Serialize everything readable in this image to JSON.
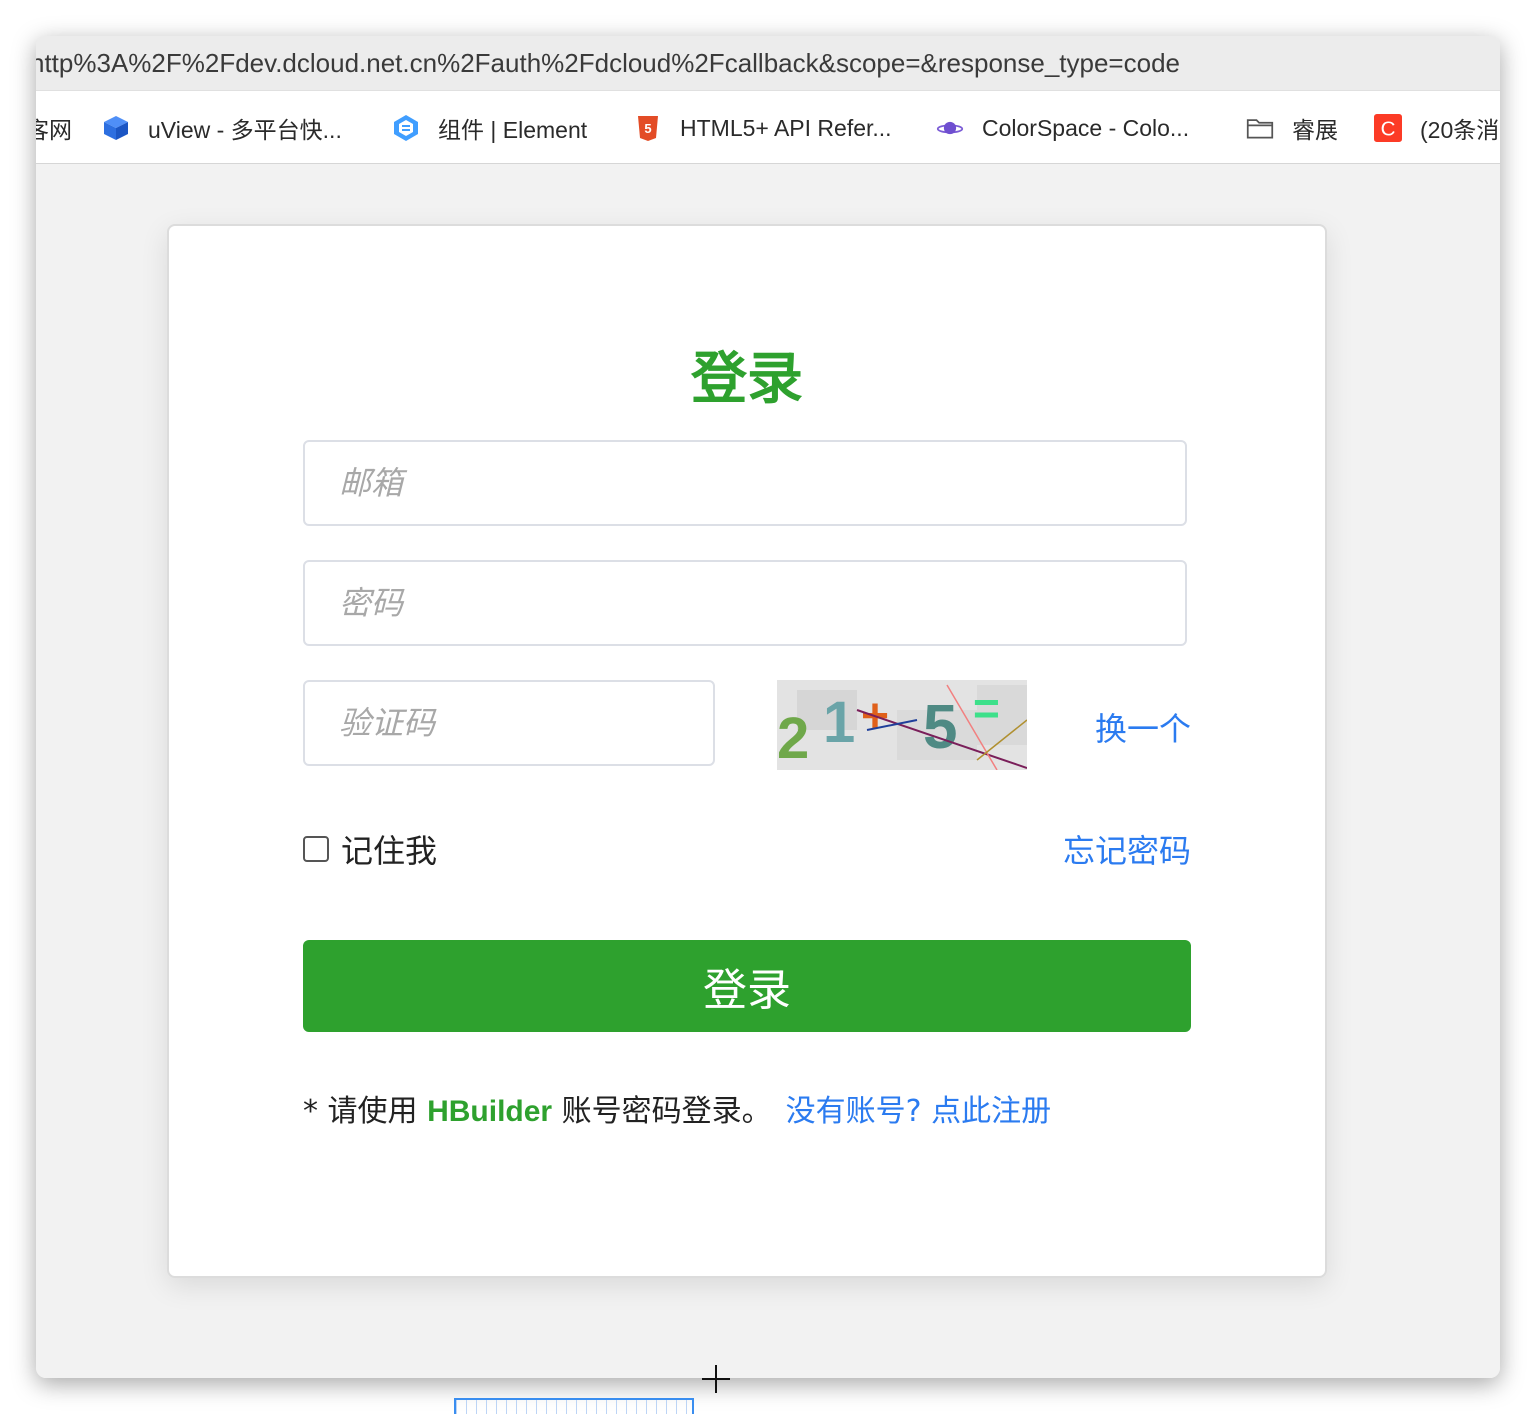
{
  "browser": {
    "url": "http%3A%2F%2Fdev.dcloud.net.cn%2Fauth%2Fdcloud%2Fcallback&scope=&response_type=code",
    "bookmarks": [
      {
        "label": "客网",
        "icon": "none"
      },
      {
        "label": "uView - 多平台快...",
        "icon": "uview-logo-icon"
      },
      {
        "label": "组件 | Element",
        "icon": "element-logo-icon"
      },
      {
        "label": "HTML5+ API Refer...",
        "icon": "html5-logo-icon"
      },
      {
        "label": "ColorSpace - Colo...",
        "icon": "planet-icon"
      },
      {
        "label": "睿展",
        "icon": "folder-icon"
      },
      {
        "label": "(20条消",
        "icon": "csdn-c-icon"
      }
    ]
  },
  "login": {
    "title": "登录",
    "email_placeholder": "邮箱",
    "password_placeholder": "密码",
    "captcha_placeholder": "验证码",
    "captcha_text": "21+5=",
    "refresh_captcha": "换一个",
    "remember_me": "记住我",
    "forgot_password": "忘记密码",
    "submit": "登录",
    "note_prefix": "* 请使用 ",
    "note_brand": "HBuilder",
    "note_suffix": " 账号密码登录。",
    "register_link": "没有账号? 点此注册"
  },
  "colors": {
    "brand_green": "#2ea12e",
    "link_blue": "#2b7bf0"
  }
}
